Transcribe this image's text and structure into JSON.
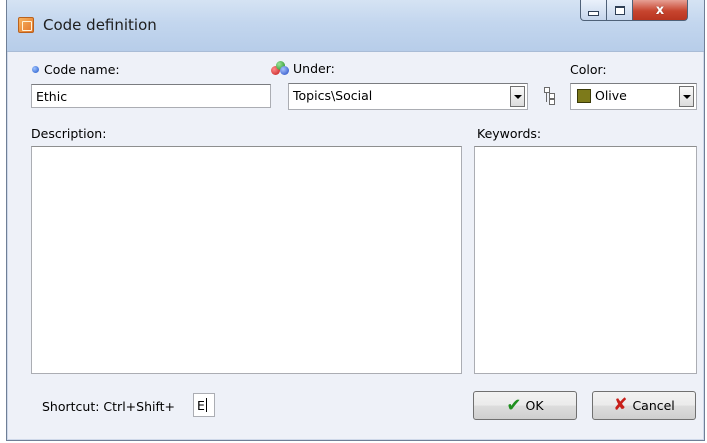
{
  "window": {
    "title": "Code definition",
    "controls": {
      "minimize_icon": "minimize-icon",
      "maximize_icon": "maximize-icon",
      "close_glyph": "x"
    }
  },
  "form": {
    "code_name_label": "Code name:",
    "code_name_value": "Ethic",
    "under_label": "Under:",
    "under_value": "Topics\\Social",
    "color_label": "Color:",
    "color_value": "Olive",
    "color_hex": "#7d7a1a",
    "description_label": "Description:",
    "description_value": "",
    "keywords_label": "Keywords:",
    "keywords_value": "",
    "shortcut_label": "Shortcut: Ctrl+Shift+",
    "shortcut_value": "E"
  },
  "buttons": {
    "ok_label": "OK",
    "cancel_label": "Cancel"
  },
  "icons": {
    "ok": "checkmark-icon",
    "cancel": "x-icon",
    "tree": "tree-browse-icon"
  }
}
